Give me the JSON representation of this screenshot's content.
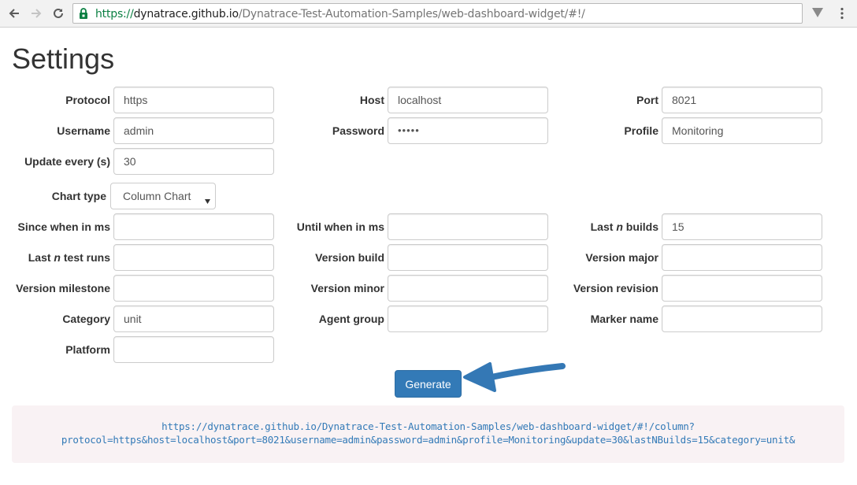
{
  "browser": {
    "url_scheme": "https://",
    "url_domain": "dynatrace.github.io",
    "url_rest": "/Dynatrace-Test-Automation-Samples/web-dashboard-widget/#!/",
    "icons": [
      "back-icon",
      "forward-icon",
      "reload-icon",
      "lock-icon",
      "star-icon",
      "extension-icon",
      "menu-icon"
    ]
  },
  "page": {
    "title": "Settings"
  },
  "form": {
    "protocol": {
      "label": "Protocol",
      "value": "https"
    },
    "host": {
      "label": "Host",
      "value": "localhost"
    },
    "port": {
      "label": "Port",
      "value": "8021"
    },
    "username": {
      "label": "Username",
      "value": "admin"
    },
    "password": {
      "label": "Password",
      "value": "•••••"
    },
    "profile": {
      "label": "Profile",
      "value": "Monitoring"
    },
    "update": {
      "label": "Update every (s)",
      "value": "30"
    },
    "chart_type": {
      "label": "Chart type",
      "value": "Column Chart"
    },
    "since": {
      "label": "Since when in ms",
      "value": ""
    },
    "until": {
      "label": "Until when in ms",
      "value": ""
    },
    "last_builds": {
      "label_pre": "Last ",
      "label_em": "n",
      "label_post": " builds",
      "value": "15"
    },
    "last_test_runs": {
      "label_pre": "Last ",
      "label_em": "n",
      "label_post": " test runs",
      "value": ""
    },
    "version_build": {
      "label": "Version build",
      "value": ""
    },
    "version_major": {
      "label": "Version major",
      "value": ""
    },
    "version_milestone": {
      "label": "Version milestone",
      "value": ""
    },
    "version_minor": {
      "label": "Version minor",
      "value": ""
    },
    "version_revision": {
      "label": "Version revision",
      "value": ""
    },
    "category": {
      "label": "Category",
      "value": "unit"
    },
    "agent_group": {
      "label": "Agent group",
      "value": ""
    },
    "marker_name": {
      "label": "Marker name",
      "value": ""
    },
    "platform": {
      "label": "Platform",
      "value": ""
    }
  },
  "generate_label": "Generate",
  "result": {
    "line1": "https://dynatrace.github.io/Dynatrace-Test-Automation-Samples/web-dashboard-widget/#!/column?",
    "line2": "protocol=https&host=localhost&port=8021&username=admin&password=admin&profile=Monitoring&update=30&lastNBuilds=15&category=unit&"
  },
  "colors": {
    "primary": "#337ab7",
    "code_bg": "#f9f2f4",
    "secure_green": "#0b8043"
  }
}
